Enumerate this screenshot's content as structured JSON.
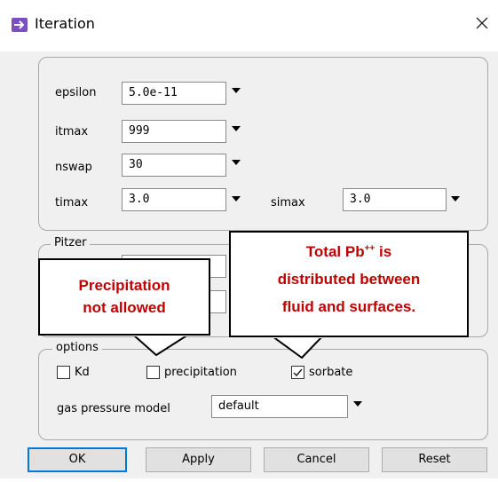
{
  "window": {
    "title": "Iteration"
  },
  "main": {
    "fields": [
      {
        "label": "epsilon",
        "value": "5.0e-11"
      },
      {
        "label": "itmax",
        "value": "999"
      },
      {
        "label": "nswap",
        "value": "30"
      },
      {
        "label": "timax",
        "value": "3.0"
      },
      {
        "label": "simax",
        "value": "3.0"
      }
    ]
  },
  "pitzer": {
    "legend": "Pitzer"
  },
  "options": {
    "legend": "options",
    "checkboxes": [
      {
        "label": "Kd",
        "checked": false
      },
      {
        "label": "precipitation",
        "checked": false
      },
      {
        "label": "sorbate",
        "checked": true
      }
    ],
    "gas_model": {
      "label": "gas pressure model",
      "value": "default"
    }
  },
  "buttons": {
    "ok": "OK",
    "apply": "Apply",
    "cancel": "Cancel",
    "reset": "Reset"
  },
  "callouts": {
    "left": {
      "line1": "Precipitation",
      "line2": "not allowed"
    },
    "right": {
      "line1_prefix": "Total Pb",
      "line1_sup": "++",
      "line1_suffix": " is",
      "line2": "distributed between",
      "line3": "fluid and surfaces."
    }
  },
  "colors": {
    "callout_text": "#c00000",
    "accent": "#0078d7",
    "icon": "#7b4ec2"
  }
}
